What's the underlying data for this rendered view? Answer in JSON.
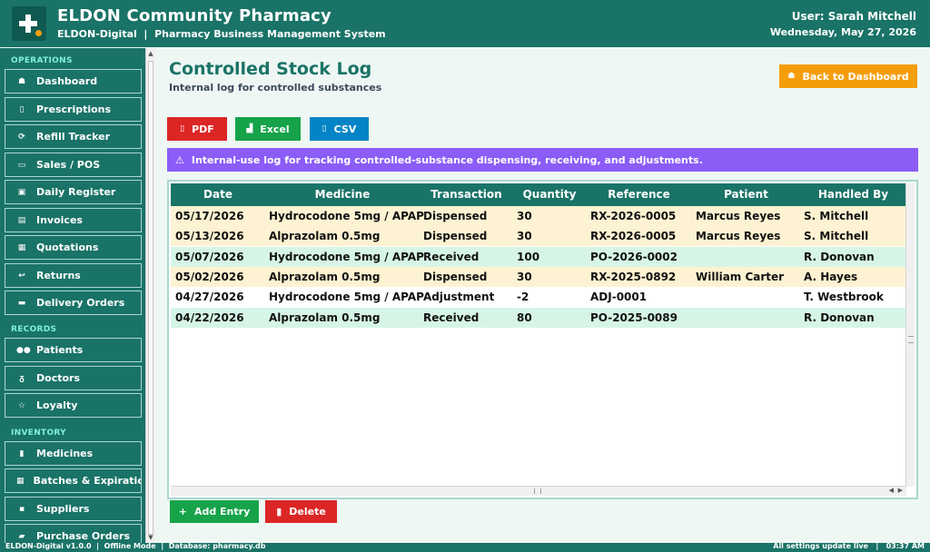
{
  "header": {
    "app_title": "ELDON Community Pharmacy",
    "app_subtitle": "ELDON-Digital  |  Pharmacy Business Management System",
    "user": "User: Sarah Mitchell",
    "date": "Wednesday, May 27, 2026"
  },
  "sidebar": {
    "sections": [
      {
        "label": "OPERATIONS",
        "items": [
          {
            "label": "Dashboard",
            "icon": "home-icon"
          },
          {
            "label": "Prescriptions",
            "icon": "clipboard-icon"
          },
          {
            "label": "Refill Tracker",
            "icon": "refresh-icon"
          },
          {
            "label": "Sales / POS",
            "icon": "register-icon"
          },
          {
            "label": "Daily Register",
            "icon": "calendar-icon"
          },
          {
            "label": "Invoices",
            "icon": "invoice-icon"
          },
          {
            "label": "Quotations",
            "icon": "quote-icon"
          },
          {
            "label": "Returns",
            "icon": "return-icon"
          },
          {
            "label": "Delivery Orders",
            "icon": "truck-icon"
          }
        ]
      },
      {
        "label": "RECORDS",
        "items": [
          {
            "label": "Patients",
            "icon": "people-icon"
          },
          {
            "label": "Doctors",
            "icon": "stethoscope-icon"
          },
          {
            "label": "Loyalty",
            "icon": "star-icon"
          }
        ]
      },
      {
        "label": "INVENTORY",
        "items": [
          {
            "label": "Medicines",
            "icon": "pill-icon"
          },
          {
            "label": "Batches & Expiratio",
            "icon": "box-icon"
          },
          {
            "label": "Suppliers",
            "icon": "supplier-icon"
          },
          {
            "label": "Purchase Orders",
            "icon": "cart-icon"
          }
        ]
      }
    ]
  },
  "page": {
    "title": "Controlled Stock Log",
    "subtitle": "Internal log for controlled substances",
    "back_label": "Back to Dashboard"
  },
  "exports": [
    {
      "label": "PDF",
      "color": "#dc2626"
    },
    {
      "label": "Excel",
      "color": "#16a34a"
    },
    {
      "label": "CSV",
      "color": "#0284c7"
    }
  ],
  "notice": "Internal-use log for tracking controlled-substance dispensing, receiving, and adjustments.",
  "table": {
    "columns": [
      "Date",
      "Medicine",
      "Transaction",
      "Quantity",
      "Reference",
      "Patient",
      "Handled By"
    ],
    "rows": [
      [
        "05/17/2026",
        "Hydrocodone 5mg / APAP",
        "Dispensed",
        "30",
        "RX-2026-0005",
        "Marcus Reyes",
        "S. Mitchell"
      ],
      [
        "05/13/2026",
        "Alprazolam 0.5mg",
        "Dispensed",
        "30",
        "RX-2026-0005",
        "Marcus Reyes",
        "S. Mitchell"
      ],
      [
        "05/07/2026",
        "Hydrocodone 5mg / APAP",
        "Received",
        "100",
        "PO-2026-0002",
        "",
        "R. Donovan"
      ],
      [
        "05/02/2026",
        "Alprazolam 0.5mg",
        "Dispensed",
        "30",
        "RX-2025-0892",
        "William Carter",
        "A. Hayes"
      ],
      [
        "04/27/2026",
        "Hydrocodone 5mg / APAP",
        "Adjustment",
        "-2",
        "ADJ-0001",
        "",
        "T. Westbrook"
      ],
      [
        "04/22/2026",
        "Alprazolam 0.5mg",
        "Received",
        "80",
        "PO-2025-0089",
        "",
        "R. Donovan"
      ]
    ]
  },
  "actions": {
    "add_label": "Add Entry",
    "delete_label": "Delete"
  },
  "status": {
    "left": "ELDON-Digital v1.0.0  |  Offline Mode  |  Database: pharmacy.db",
    "right": "All settings update live   |   03:37 AM"
  },
  "colors": {
    "primary": "#1a7367",
    "accent": "#f59e0b",
    "notice": "#8b5cf6",
    "dispensed_row": "#fdf3d2",
    "received_row": "#d6f5e6"
  }
}
